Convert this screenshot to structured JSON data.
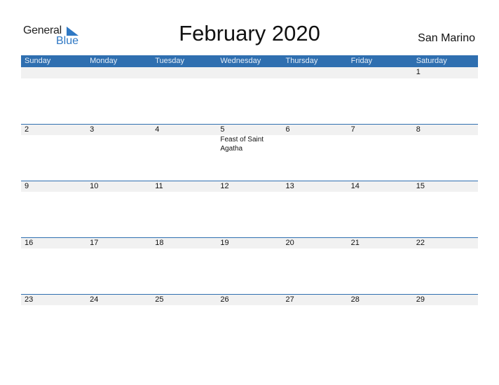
{
  "logo": {
    "word1": "General",
    "word2": "Blue"
  },
  "title": "February 2020",
  "country": "San Marino",
  "colors": {
    "accent": "#2f6fb0",
    "date_strip": "#f1f1f1",
    "logo_blue": "#2f78c4"
  },
  "weekdays": [
    "Sunday",
    "Monday",
    "Tuesday",
    "Wednesday",
    "Thursday",
    "Friday",
    "Saturday"
  ],
  "weeks": [
    {
      "days": [
        "",
        "",
        "",
        "",
        "",
        "",
        "1"
      ],
      "events": [
        "",
        "",
        "",
        "",
        "",
        "",
        ""
      ]
    },
    {
      "days": [
        "2",
        "3",
        "4",
        "5",
        "6",
        "7",
        "8"
      ],
      "events": [
        "",
        "",
        "",
        "Feast of Saint Agatha",
        "",
        "",
        ""
      ]
    },
    {
      "days": [
        "9",
        "10",
        "11",
        "12",
        "13",
        "14",
        "15"
      ],
      "events": [
        "",
        "",
        "",
        "",
        "",
        "",
        ""
      ]
    },
    {
      "days": [
        "16",
        "17",
        "18",
        "19",
        "20",
        "21",
        "22"
      ],
      "events": [
        "",
        "",
        "",
        "",
        "",
        "",
        ""
      ]
    },
    {
      "days": [
        "23",
        "24",
        "25",
        "26",
        "27",
        "28",
        "29"
      ],
      "events": [
        "",
        "",
        "",
        "",
        "",
        "",
        ""
      ]
    }
  ]
}
